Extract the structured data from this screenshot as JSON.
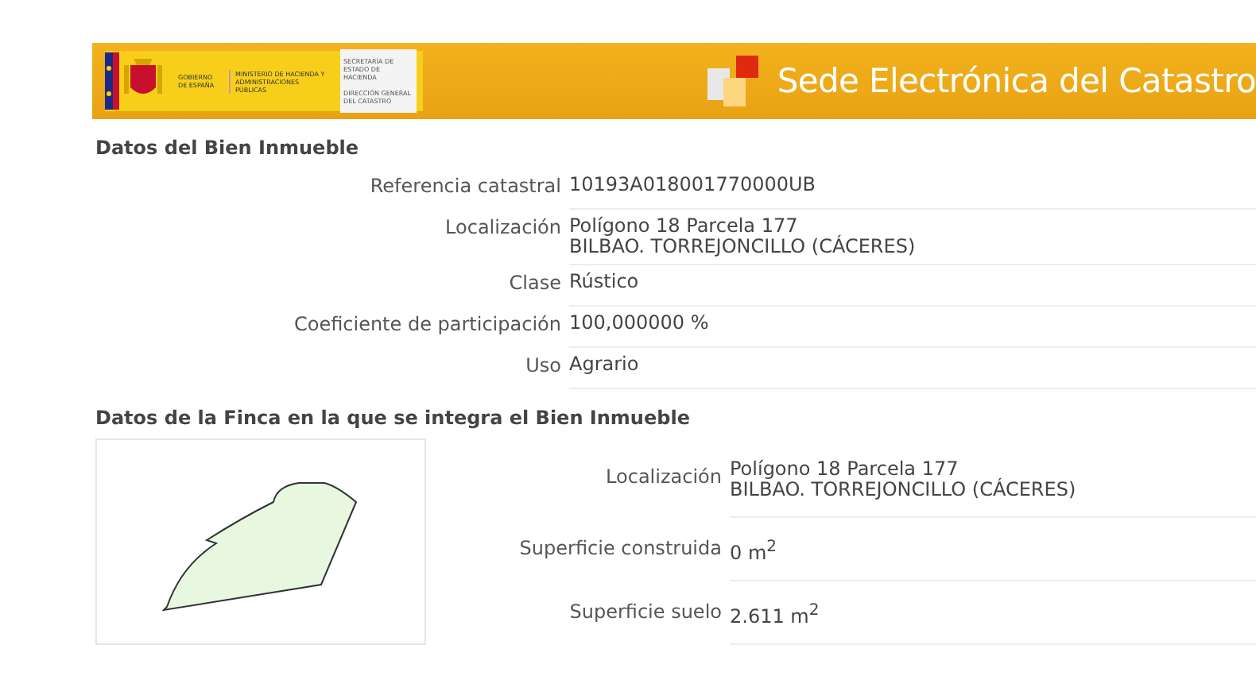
{
  "header": {
    "logo_texts": [
      "GOBIERNO DE ESPAÑA",
      "MINISTERIO DE HACIENDA Y ADMINISTRACIONES PÚBLICAS"
    ],
    "agency_texts": [
      "SECRETARÍA DE ESTADO DE HACIENDA",
      "DIRECCIÓN GENERAL DEL CATASTRO"
    ],
    "title": "Sede Electrónica del Catastro"
  },
  "inmueble": {
    "title": "Datos del Bien Inmueble",
    "rows": [
      {
        "label": "Referencia catastral",
        "value": [
          "10193A018001770000UB"
        ]
      },
      {
        "label": "Localización",
        "value": [
          "Polígono 18 Parcela 177",
          "BILBAO. TORREJONCILLO (CÁCERES)"
        ]
      },
      {
        "label": "Clase",
        "value": [
          "Rústico"
        ]
      },
      {
        "label": "Coeficiente de participación",
        "value": [
          "100,000000 %"
        ]
      },
      {
        "label": "Uso",
        "value": [
          "Agrario"
        ]
      }
    ]
  },
  "finca": {
    "title": "Datos de la Finca en la que se integra el Bien Inmueble",
    "rows": [
      {
        "label": "Localización",
        "value": [
          "Polígono 18 Parcela 177",
          "BILBAO. TORREJONCILLO (CÁCERES)"
        ]
      },
      {
        "label": "Superficie construida",
        "value": [
          "0 m$^{2}$"
        ]
      },
      {
        "label": "Superficie suelo",
        "value": [
          "2.611 m$^{2}$"
        ]
      }
    ]
  }
}
